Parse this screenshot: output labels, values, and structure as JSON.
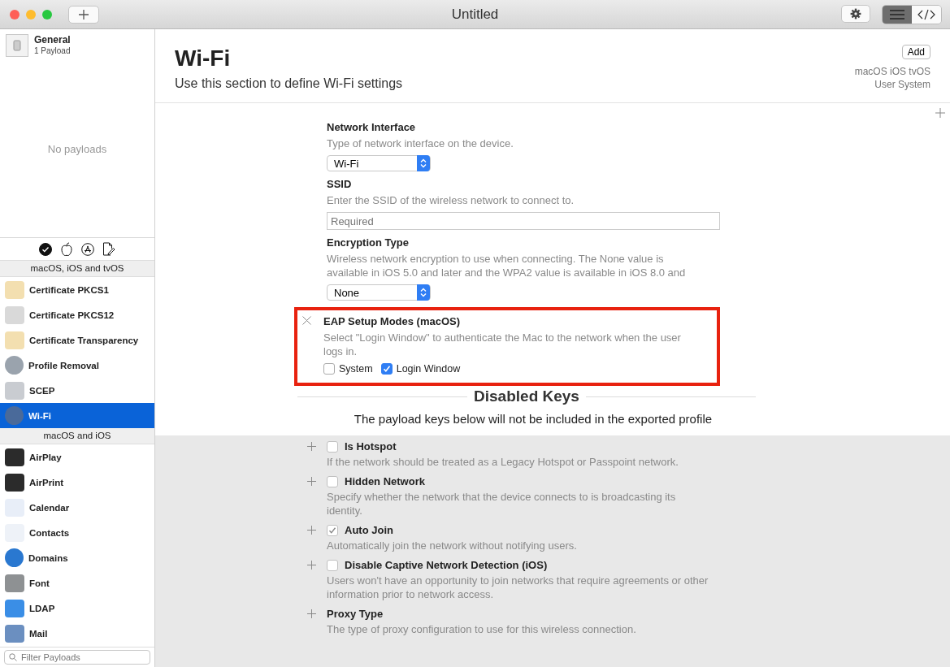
{
  "window": {
    "title": "Untitled",
    "view_toggle": [
      {
        "kind": "list",
        "selected": true
      },
      {
        "kind": "code",
        "selected": false
      }
    ]
  },
  "sidebar": {
    "general": {
      "title": "General",
      "subtitle": "1 Payload"
    },
    "empty_text": "No payloads",
    "platform_filters": [
      {
        "kind": "all",
        "selected": true
      },
      {
        "kind": "apple",
        "selected": false
      },
      {
        "kind": "appstore",
        "selected": false
      },
      {
        "kind": "doc",
        "selected": false
      }
    ],
    "groups": [
      {
        "title": "macOS, iOS and tvOS",
        "items": [
          {
            "label": "Certificate PKCS1",
            "selected": false
          },
          {
            "label": "Certificate PKCS12",
            "selected": false
          },
          {
            "label": "Certificate Transparency",
            "selected": false
          },
          {
            "label": "Profile Removal",
            "selected": false
          },
          {
            "label": "SCEP",
            "selected": false
          },
          {
            "label": "Wi-Fi",
            "selected": true
          }
        ]
      },
      {
        "title": "macOS and iOS",
        "items": [
          {
            "label": "AirPlay",
            "selected": false
          },
          {
            "label": "AirPrint",
            "selected": false
          },
          {
            "label": "Calendar",
            "selected": false
          },
          {
            "label": "Contacts",
            "selected": false
          },
          {
            "label": "Domains",
            "selected": false
          },
          {
            "label": "Font",
            "selected": false
          },
          {
            "label": "LDAP",
            "selected": false
          },
          {
            "label": "Mail",
            "selected": false
          }
        ]
      }
    ],
    "filter": {
      "placeholder": "Filter Payloads"
    }
  },
  "header": {
    "title": "Wi-Fi",
    "description": "Use this section to define Wi-Fi settings",
    "add_button": "Add",
    "platforms": "macOS iOS tvOS",
    "scopes": "User System"
  },
  "keys": [
    {
      "kind": "popup",
      "title": "Network Interface",
      "description": "Type of network interface on the device.",
      "value": "Wi-Fi"
    },
    {
      "kind": "text",
      "title": "SSID",
      "description": "Enter the SSID of the wireless network to connect to.",
      "placeholder": "Required"
    },
    {
      "kind": "popup",
      "title": "Encryption Type",
      "description": "Wireless network encryption to use when connecting. The None value is available in iOS 5.0 and later and the WPA2 value is available in iOS 8.0 and",
      "value": "None"
    },
    {
      "kind": "checkboxes",
      "title": "EAP Setup Modes (macOS)",
      "description": "Select \"Login Window\" to authenticate the Mac to the network when the user logs in.",
      "highlighted": true,
      "options": [
        {
          "label": "System",
          "checked": false
        },
        {
          "label": "Login Window",
          "checked": true
        }
      ]
    }
  ],
  "disabled_section": {
    "title": "Disabled Keys",
    "description": "The payload keys below will not be included in the exported profile"
  },
  "disabled_keys": [
    {
      "kind": "checkbox",
      "title": "Is Hotspot",
      "checked": false,
      "description": "If the network should be treated as a Legacy Hotspot or Passpoint network."
    },
    {
      "kind": "checkbox",
      "title": "Hidden Network",
      "checked": false,
      "description": "Specify whether the network that the device connects to is broadcasting its identity."
    },
    {
      "kind": "checkbox",
      "title": "Auto Join",
      "checked": true,
      "description": "Automatically join the network without notifying users."
    },
    {
      "kind": "checkbox",
      "title": "Disable Captive Network Detection (iOS)",
      "checked": false,
      "description": "Users won't have an opportunity to join networks that require agreements or other information prior to network access."
    },
    {
      "kind": "popup",
      "title": "Proxy Type",
      "description": "The type of proxy configuration to use for this wireless connection."
    }
  ]
}
